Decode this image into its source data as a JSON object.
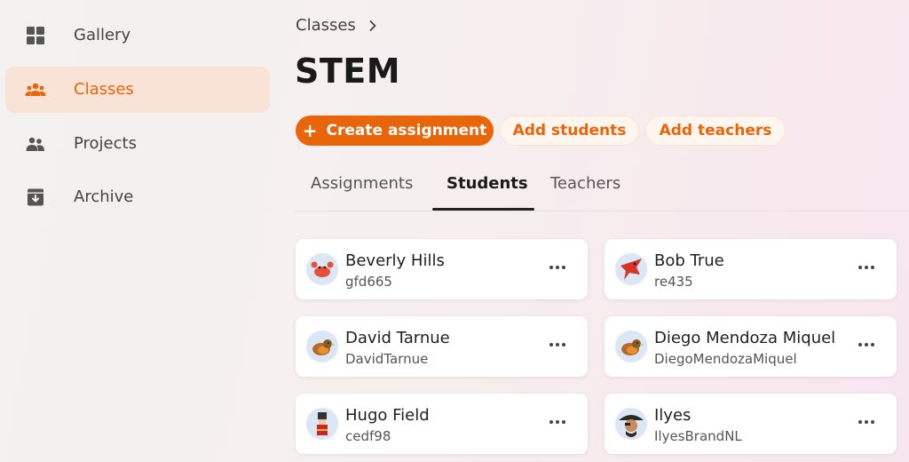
{
  "sidebar": {
    "items": [
      {
        "label": "Gallery",
        "icon": "grid-icon",
        "active": false
      },
      {
        "label": "Classes",
        "icon": "people-icon",
        "active": true
      },
      {
        "label": "Projects",
        "icon": "group-icon",
        "active": false
      },
      {
        "label": "Archive",
        "icon": "archive-icon",
        "active": false
      }
    ]
  },
  "breadcrumb": {
    "label": "Classes"
  },
  "page": {
    "title": "STEM"
  },
  "actions": {
    "create": "Create assignment",
    "add_students": "Add students",
    "add_teachers": "Add teachers"
  },
  "tabs": [
    {
      "label": "Assignments"
    },
    {
      "label": "Students"
    },
    {
      "label": "Teachers"
    }
  ],
  "active_tab": "Students",
  "students": [
    {
      "name": "Beverly Hills",
      "username": "gfd665",
      "avatar": "crab-avatar"
    },
    {
      "name": "Bob True",
      "username": "re435",
      "avatar": "bird-avatar"
    },
    {
      "name": "David Tarnue",
      "username": "DavidTarnue",
      "avatar": "robin-avatar"
    },
    {
      "name": "Diego Mendoza Miquel",
      "username": "DiegoMendozaMiquel",
      "avatar": "robin-avatar"
    },
    {
      "name": "Hugo Field",
      "username": "cedf98",
      "avatar": "nutcracker-avatar"
    },
    {
      "name": "Ilyes",
      "username": "IlyesBrandNL",
      "avatar": "pirate-avatar"
    }
  ],
  "colors": {
    "accent": "#e8650a",
    "active_bg": "#f8e3d6"
  }
}
